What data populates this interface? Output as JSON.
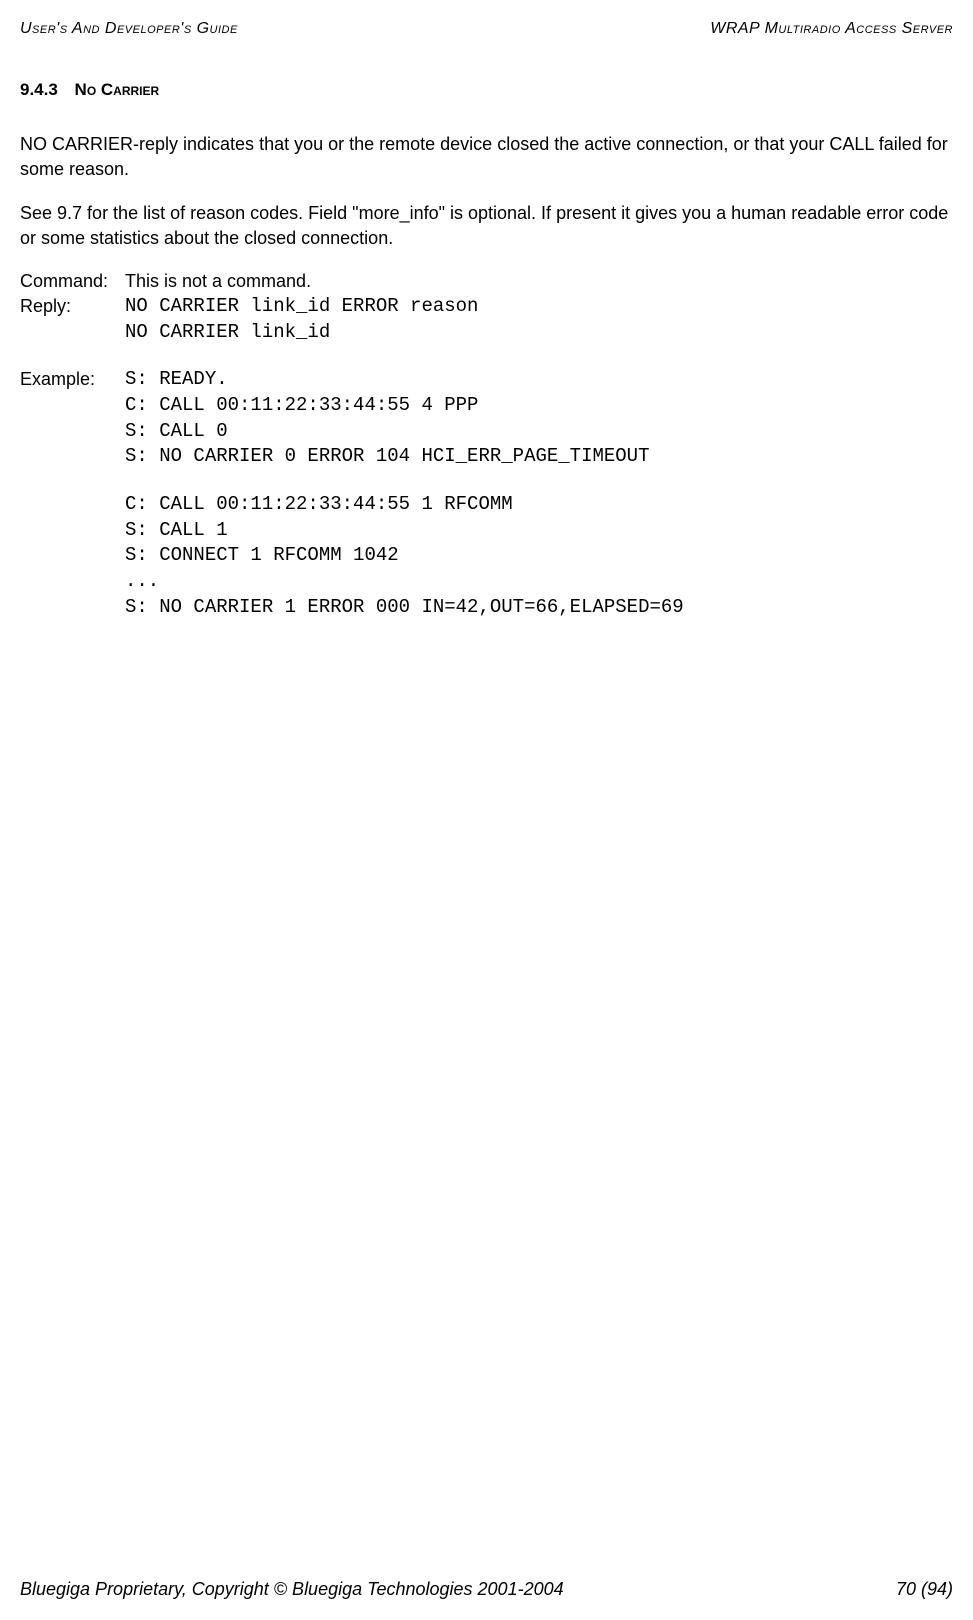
{
  "header": {
    "left": "User's And Developer's Guide",
    "right": "WRAP Multiradio Access Server"
  },
  "section": {
    "number": "9.4.3",
    "title": "No Carrier"
  },
  "paragraphs": {
    "p1": "NO CARRIER-reply indicates that you or the remote device closed the active connection, or that your CALL failed for some reason.",
    "p2": "See 9.7 for the list of reason codes. Field \"more_info\" is optional. If present it gives you a human readable error code or some statistics about the closed connection."
  },
  "defs": {
    "command_label": "Command:",
    "command_value": "This is not a command.",
    "reply_label": "Reply:",
    "reply_value": "NO CARRIER link_id ERROR reason\nNO CARRIER link_id",
    "example_label": "Example:",
    "example_value_1": "S: READY.\nC: CALL 00:11:22:33:44:55 4 PPP\nS: CALL 0\nS: NO CARRIER 0 ERROR 104 HCI_ERR_PAGE_TIMEOUT",
    "example_value_2": "C: CALL 00:11:22:33:44:55 1 RFCOMM\nS: CALL 1\nS: CONNECT 1 RFCOMM 1042\n...\nS: NO CARRIER 1 ERROR 000 IN=42,OUT=66,ELAPSED=69"
  },
  "footer": {
    "left": "Bluegiga Proprietary, Copyright © Bluegiga Technologies 2001-2004",
    "right": "70 (94)"
  }
}
